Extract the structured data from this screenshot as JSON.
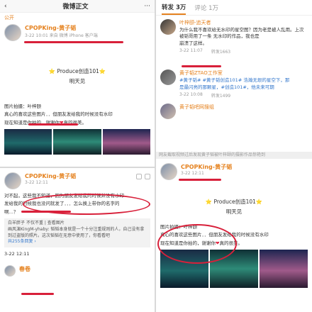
{
  "p1": {
    "back": "‹",
    "title": "微博正文",
    "more": "···",
    "follow": "公开",
    "username": "CPOPKing-黄子韬",
    "meta": "3-22 10:01  来自 微博 iPhone 客户端",
    "center_text": "⭐ Produce创造101⭐",
    "center_sub": "明天见",
    "body_1": "图片拍摄：叶梓颐",
    "body_2": "真心的喜欢这些图片．．但朋友发给我的时候没有水印",
    "body_3": "现在知道是你拍的，谢谢你",
    "body_3b": "真的很美。"
  },
  "p2": {
    "tab_active": "转发 3万",
    "tab_2": "评论 1万",
    "comments": [
      {
        "name": "叶梓颐-追天者",
        "text": "为什么我不喜欢给无水印的星空图？因为老是被人乱用。上次被韬哥用了一条 无水印的作品，我也是",
        "text2": "崩溃了这样。",
        "time": "3-22 11:07",
        "stat": "转发1663"
      },
      {
        "name": "黄子韬ZTAO工作室",
        "text": "#黄子韬# #黄子韬创造101# 浩瀚无垠的星空下，那",
        "text2": "是最闪亮的那颗星，#创造101#，他未来可期",
        "time": "3-22 10:08",
        "stat": "转发1499"
      },
      {
        "name": "黄子韬吧网搜组"
      }
    ]
  },
  "strip": "网友截取视频过后发现黄子韬被叶梓颐的摄影作品惊艳到",
  "p3": {
    "username": "CPOPKing-黄子韬",
    "time_user": "3-22 12:11",
    "text_1": "对不起，这些我不知道，因为朋友发给我的时候并没有水印",
    "text_2": "发给我的时候我也没问就发了．．．怎么换上带你的名字的",
    "text_3": "啊…？",
    "reply_head": "图片拍摄：叶梓颐",
    "reply_user": "白羊胖子",
    "reply_text": "不仅不重 | 查看图片",
    "reply_body": "画风演KingM-yhaby: 韬韬本身就是一个十分注重规则的人，自己没有拿到过盗版的照片。这次韬韬在无意中使用了，你看看吧",
    "reply_more": "共255条回复 ›",
    "time": "3-22 12:11",
    "next_user": "春卷"
  },
  "p4": {
    "username": "CPOPKing-黄子韬",
    "meta": "3-22 12:11",
    "center_text": "⭐ Produce创造101⭐",
    "center_sub": "明天见",
    "body_1": "图片拍摄：叶梓颐",
    "body_2": "真心的喜欢这些图片．．但朋友发给我的时候没有水印",
    "body_3": "现在知道是你拍的，谢谢你",
    "body_3b": "真的很美。"
  }
}
